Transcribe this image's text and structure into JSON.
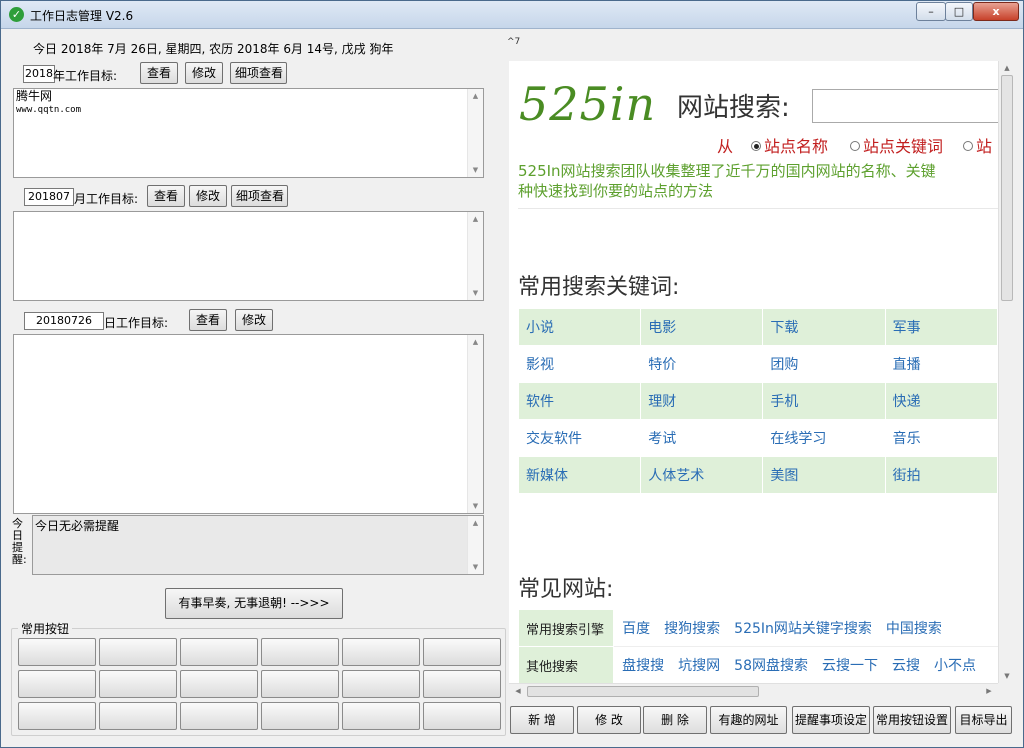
{
  "window": {
    "title": "工作日志管理 V2.6",
    "minimize": "–",
    "maximize": "□",
    "close": "x"
  },
  "header": {
    "date_line": "今日 2018年 7月 26日, 星期四, 农历 2018年 6月 14号, 戊戌 狗年",
    "marks": "^7"
  },
  "year": {
    "value": "2018",
    "label": "年工作目标:",
    "view": "查看",
    "edit": "修改",
    "detail": "细项查看",
    "content_line1": "腾牛网",
    "content_line2": "www.qqtn.com"
  },
  "month": {
    "value": "201807",
    "label": "月工作目标:",
    "view": "查看",
    "edit": "修改",
    "detail": "细项查看"
  },
  "day": {
    "value": "20180726",
    "label": "日工作目标:",
    "view": "查看",
    "edit": "修改"
  },
  "reminder": {
    "label": "今日提醒:",
    "text": "今日无必需提醒"
  },
  "main_button": "有事早奏, 无事退朝! -->>>",
  "common_buttons": {
    "title": "常用按钮"
  },
  "browser": {
    "logo": "525in",
    "search_title": "网站搜索:",
    "from": "从",
    "options": [
      "站点名称",
      "站点关键词",
      "站"
    ],
    "intro_line1": "525In网站搜索团队收集整理了近千万的国内网站的名称、关键",
    "intro_line2": "种快速找到你要的站点的方法",
    "keywords_title": "常用搜索关键词:",
    "keywords": [
      [
        "小说",
        "电影",
        "下载",
        "军事"
      ],
      [
        "影视",
        "特价",
        "团购",
        "直播"
      ],
      [
        "软件",
        "理财",
        "手机",
        "快递"
      ],
      [
        "交友软件",
        "考试",
        "在线学习",
        "音乐"
      ],
      [
        "新媒体",
        "人体艺术",
        "美图",
        "街拍"
      ]
    ],
    "sites_title": "常见网站:",
    "sites": [
      {
        "category": "常用搜索引擎",
        "links": [
          "百度",
          "搜狗搜索",
          "525In网站关键字搜索",
          "中国搜索"
        ]
      },
      {
        "category": "其他搜索",
        "links": [
          "盘搜搜",
          "坑搜网",
          "58网盘搜索",
          "云搜一下",
          "云搜",
          "小不点"
        ]
      }
    ]
  },
  "bottom_buttons": [
    "新 增",
    "修 改",
    "删 除",
    "有趣的网址",
    "提醒事项设定",
    "常用按钮设置",
    "目标导出"
  ]
}
